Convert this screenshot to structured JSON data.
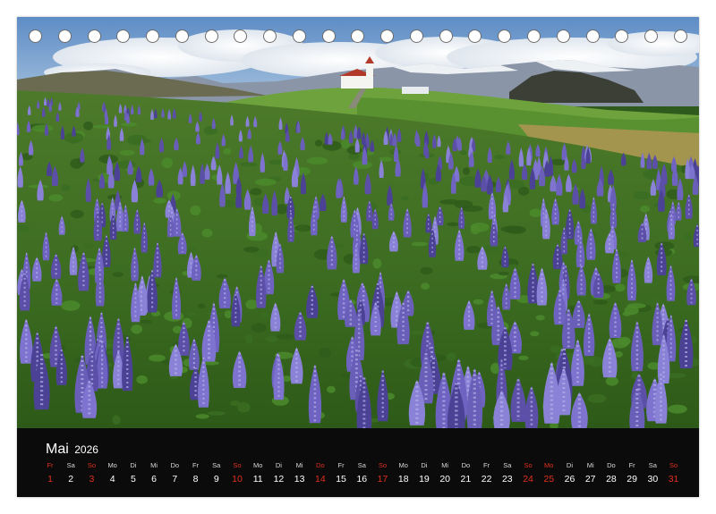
{
  "calendar": {
    "month": "Mai",
    "year": "2026",
    "holiday_color": "#e0301e",
    "text_color": "#ffffff",
    "background_color": "#0b0b0b",
    "binding_holes": 23,
    "days": [
      {
        "wd": "Fr",
        "n": "1",
        "red": true
      },
      {
        "wd": "Sa",
        "n": "2",
        "red": false
      },
      {
        "wd": "So",
        "n": "3",
        "red": true
      },
      {
        "wd": "Mo",
        "n": "4",
        "red": false
      },
      {
        "wd": "Di",
        "n": "5",
        "red": false
      },
      {
        "wd": "Mi",
        "n": "6",
        "red": false
      },
      {
        "wd": "Do",
        "n": "7",
        "red": false
      },
      {
        "wd": "Fr",
        "n": "8",
        "red": false
      },
      {
        "wd": "Sa",
        "n": "9",
        "red": false
      },
      {
        "wd": "So",
        "n": "10",
        "red": true
      },
      {
        "wd": "Mo",
        "n": "11",
        "red": false
      },
      {
        "wd": "Di",
        "n": "12",
        "red": false
      },
      {
        "wd": "Mi",
        "n": "13",
        "red": false
      },
      {
        "wd": "Do",
        "n": "14",
        "red": true
      },
      {
        "wd": "Fr",
        "n": "15",
        "red": false
      },
      {
        "wd": "Sa",
        "n": "16",
        "red": false
      },
      {
        "wd": "So",
        "n": "17",
        "red": true
      },
      {
        "wd": "Mo",
        "n": "18",
        "red": false
      },
      {
        "wd": "Di",
        "n": "19",
        "red": false
      },
      {
        "wd": "Mi",
        "n": "20",
        "red": false
      },
      {
        "wd": "Do",
        "n": "21",
        "red": false
      },
      {
        "wd": "Fr",
        "n": "22",
        "red": false
      },
      {
        "wd": "Sa",
        "n": "23",
        "red": false
      },
      {
        "wd": "So",
        "n": "24",
        "red": true
      },
      {
        "wd": "Mo",
        "n": "25",
        "red": true
      },
      {
        "wd": "Di",
        "n": "26",
        "red": false
      },
      {
        "wd": "Mi",
        "n": "27",
        "red": false
      },
      {
        "wd": "Do",
        "n": "28",
        "red": false
      },
      {
        "wd": "Fr",
        "n": "29",
        "red": false
      },
      {
        "wd": "Sa",
        "n": "30",
        "red": false
      },
      {
        "wd": "So",
        "n": "31",
        "red": true
      }
    ]
  },
  "photo": {
    "subject": "lupine-field-with-church",
    "sky_color": "#6f9bd0",
    "cloud_color": "#eef2f6",
    "grass_color": "#5f8f2e",
    "flower_color": "#6a5fb8"
  }
}
